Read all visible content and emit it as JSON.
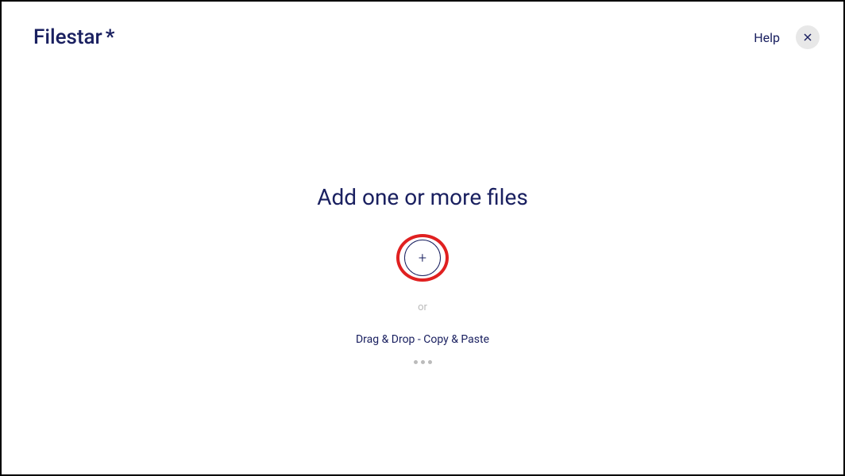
{
  "header": {
    "logo_text": "Filestar",
    "logo_star": "*",
    "help_label": "Help"
  },
  "main": {
    "title": "Add one or more files",
    "add_symbol": "+",
    "or_text": "or",
    "drag_drop_text": "Drag & Drop - Copy & Paste"
  }
}
